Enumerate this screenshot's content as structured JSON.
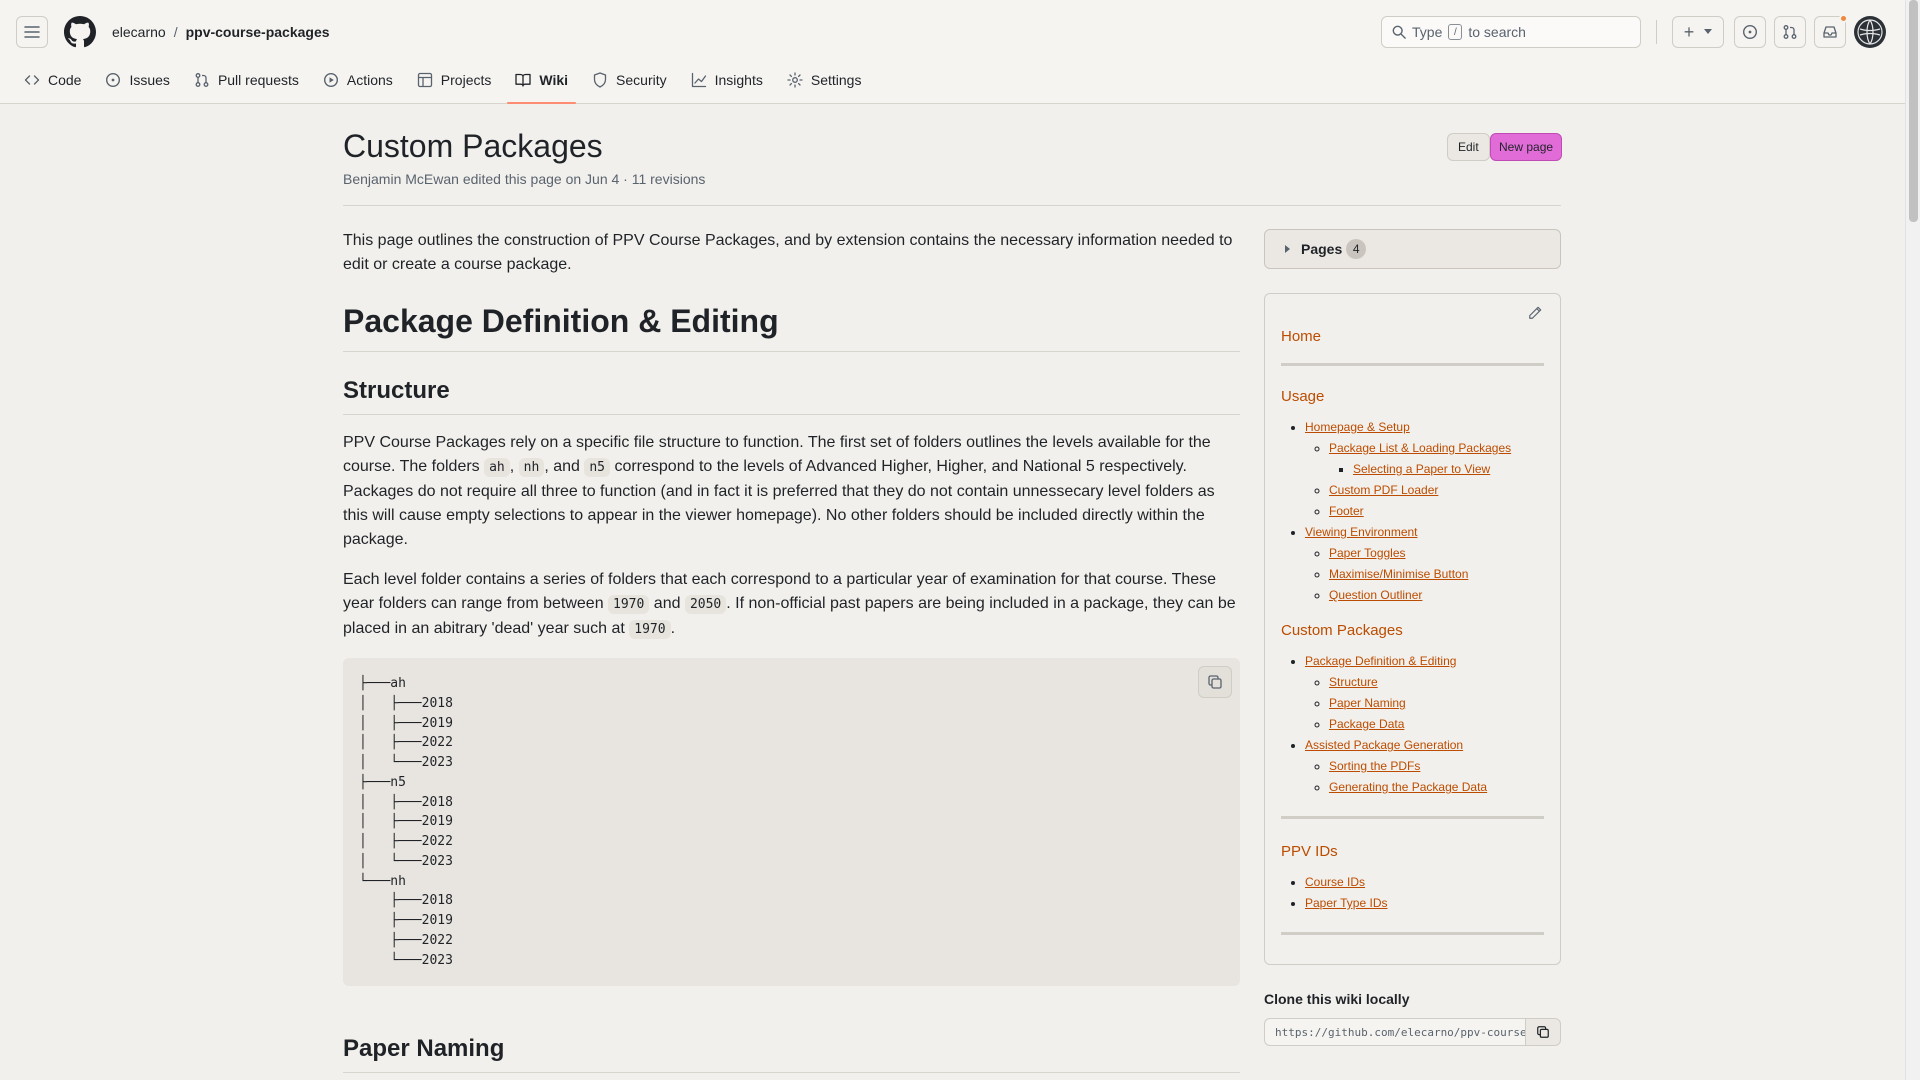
{
  "header": {
    "owner": "elecarno",
    "separator": "/",
    "repo": "ppv-course-packages",
    "search_prefix": "Type",
    "search_key": "/",
    "search_suffix": "to search",
    "plus_label": "+"
  },
  "tabs": [
    {
      "label": "Code",
      "icon": "code-icon"
    },
    {
      "label": "Issues",
      "icon": "issue-icon"
    },
    {
      "label": "Pull requests",
      "icon": "pull-request-icon"
    },
    {
      "label": "Actions",
      "icon": "play-icon"
    },
    {
      "label": "Projects",
      "icon": "table-icon"
    },
    {
      "label": "Wiki",
      "icon": "book-icon",
      "active": true
    },
    {
      "label": "Security",
      "icon": "shield-icon"
    },
    {
      "label": "Insights",
      "icon": "graph-icon"
    },
    {
      "label": "Settings",
      "icon": "gear-icon"
    }
  ],
  "page": {
    "title": "Custom Packages",
    "meta": "Benjamin McEwan edited this page on Jun 4 · 11 revisions",
    "edit_label": "Edit",
    "new_page_label": "New page"
  },
  "content": {
    "intro": "This page outlines the construction of PPV Course Packages, and by extension contains the necessary information needed to edit or create a course package.",
    "h1": "Package Definition & Editing",
    "h2_structure": "Structure",
    "p1_a": "PPV Course Packages rely on a specific file structure to function. The first set of folders outlines the levels available for the course. The folders ",
    "p1_code1": "ah",
    "p1_b": ", ",
    "p1_code2": "nh",
    "p1_c": ", and ",
    "p1_code3": "n5",
    "p1_d": " correspond to the levels of Advanced Higher, Higher, and National 5 respectively. Packages do not require all three to function (and in fact it is preferred that they do not contain unnessecary level folders as this will cause empty selections to appear in the viewer homepage). No other folders should be included directly within the package.",
    "p2_a": "Each level folder contains a series of folders that each correspond to a particular year of examination for that course. These year folders can range from between ",
    "p2_code1": "1970",
    "p2_b": " and ",
    "p2_code2": "2050",
    "p2_c": ". If non-official past papers are being included in a package, they can be placed in an abitrary 'dead' year such at ",
    "p2_code3": "1970",
    "p2_d": ".",
    "tree": [
      "├───ah",
      "│   ├───2018",
      "│   ├───2019",
      "│   ├───2022",
      "│   └───2023",
      "├───n5",
      "│   ├───2018",
      "│   ├───2019",
      "│   ├───2022",
      "│   └───2023",
      "└───nh",
      "    ├───2018",
      "    ├───2019",
      "    ├───2022",
      "    └───2023"
    ],
    "h2_paper_naming": "Paper Naming"
  },
  "sidebar": {
    "pages_label": "Pages",
    "pages_count": "4",
    "toc": {
      "home": "Home",
      "usage": {
        "heading": "Usage",
        "homepage": "Homepage & Setup",
        "package_list": "Package List & Loading Packages",
        "selecting": "Selecting a Paper to View",
        "custom_pdf": "Custom PDF Loader",
        "footer": "Footer",
        "viewing": "Viewing Environment",
        "paper_toggles": "Paper Toggles",
        "maximise": "Maximise/Minimise Button",
        "outliner": "Question Outliner"
      },
      "custom": {
        "heading": "Custom Packages",
        "pkg_def": "Package Definition & Editing",
        "structure": "Structure",
        "paper_naming": "Paper Naming",
        "package_data": "Package Data",
        "assisted": "Assisted Package Generation",
        "sorting": "Sorting the PDFs",
        "generating": "Generating the Package Data"
      },
      "ids": {
        "heading": "PPV IDs",
        "course_ids": "Course IDs",
        "paper_type_ids": "Paper Type IDs"
      }
    },
    "clone_label": "Clone this wiki locally",
    "clone_url": "https://github.com/elecarno/ppv-course-packages.wiki.git"
  }
}
